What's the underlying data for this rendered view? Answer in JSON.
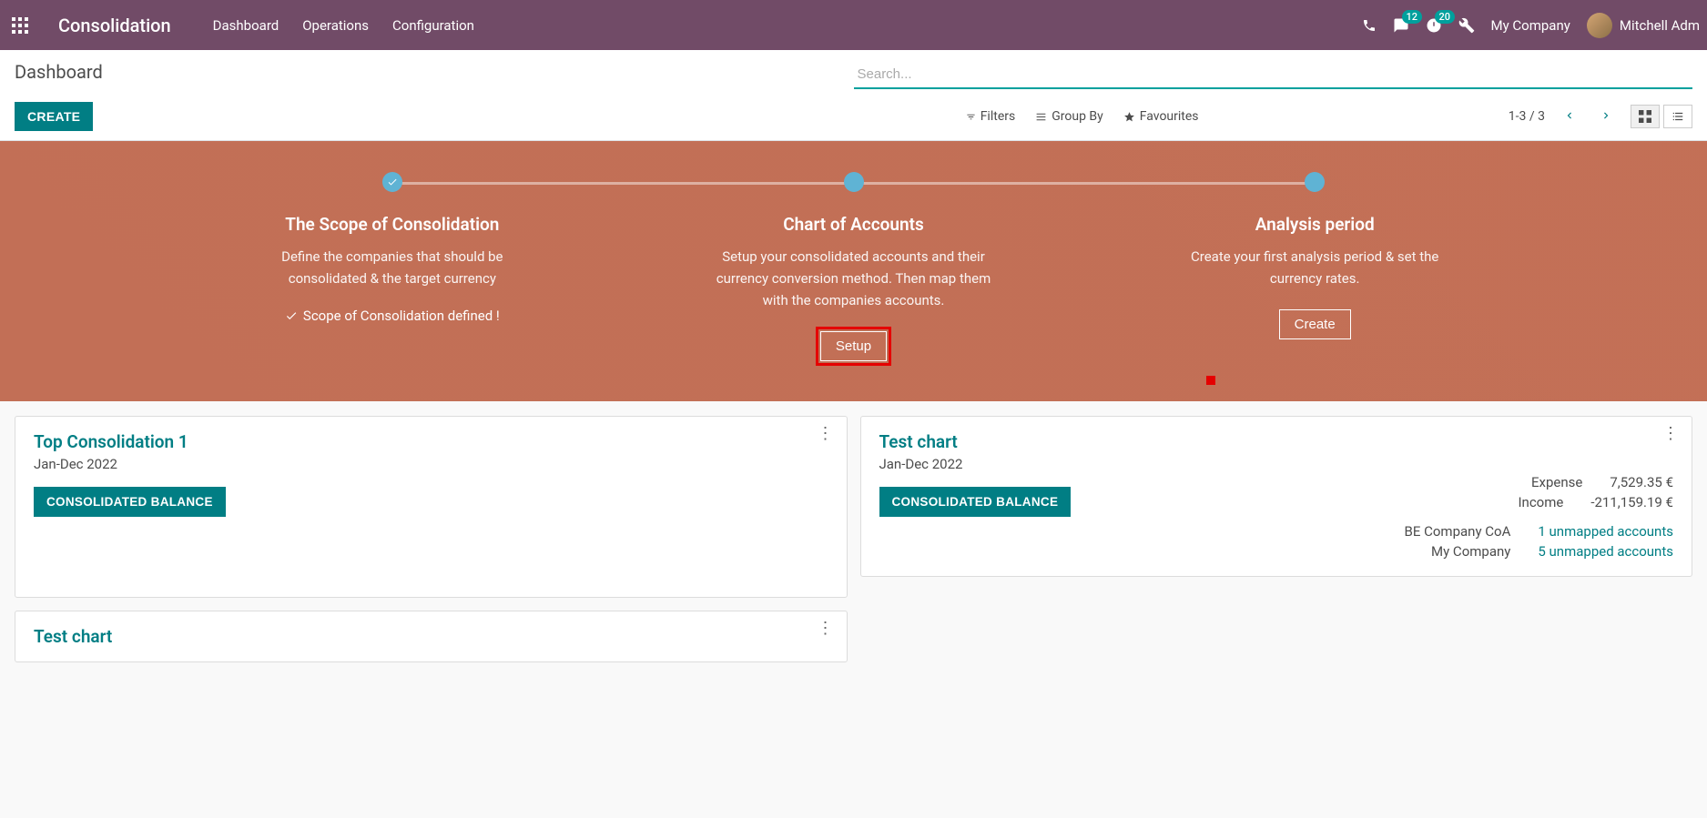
{
  "navbar": {
    "brand": "Consolidation",
    "menu": [
      "Dashboard",
      "Operations",
      "Configuration"
    ],
    "messages_badge": "12",
    "activities_badge": "20",
    "company": "My Company",
    "user": "Mitchell Adm"
  },
  "control_panel": {
    "breadcrumb": "Dashboard",
    "create_label": "CREATE",
    "search_placeholder": "Search...",
    "filters_label": "Filters",
    "groupby_label": "Group By",
    "favourites_label": "Favourites",
    "pager": "1-3 / 3"
  },
  "onboarding": {
    "steps": [
      {
        "title": "The Scope of Consolidation",
        "desc": "Define the companies that should be consolidated & the target currency",
        "status": "Scope of Consolidation defined !"
      },
      {
        "title": "Chart of Accounts",
        "desc": "Setup your consolidated accounts and their currency conversion method. Then map them with the companies accounts.",
        "button": "Setup"
      },
      {
        "title": "Analysis period",
        "desc": "Create your first analysis period & set the currency rates.",
        "button": "Create"
      }
    ]
  },
  "cards": [
    {
      "title": "Top Consolidation 1",
      "period": "Jan-Dec 2022",
      "action": "CONSOLIDATED BALANCE"
    },
    {
      "title": "Test chart",
      "period": "Jan-Dec 2022",
      "action": "CONSOLIDATED BALANCE",
      "finance": [
        {
          "label": "Expense",
          "value": "7,529.35 €"
        },
        {
          "label": "Income",
          "value": "-211,159.19 €"
        }
      ],
      "mappings": [
        {
          "label": "BE Company CoA",
          "link": "1 unmapped accounts"
        },
        {
          "label": "My Company",
          "link": "5 unmapped accounts"
        }
      ]
    },
    {
      "title": "Test chart"
    }
  ]
}
